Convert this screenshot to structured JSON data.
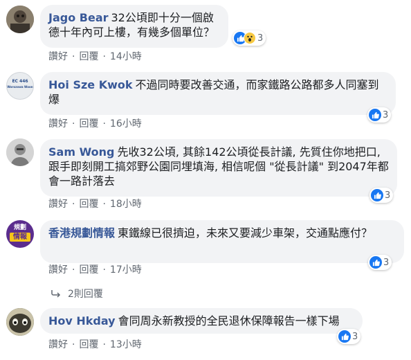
{
  "colors": {
    "name": "#385898",
    "bubble": "#f2f3f5",
    "like": "#1877f2",
    "meta": "#606770"
  },
  "actions": {
    "like": "讚好",
    "reply": "回覆",
    "sep": "·"
  },
  "comments": [
    {
      "name": "Jago Bear",
      "text": "32公頃即十分一個啟德十年內可上樓，有幾多個單位？",
      "time": "14小時",
      "reactions": "3",
      "icons": [
        "like-icon",
        "wow-icon"
      ]
    },
    {
      "name": "Hoi Sze Kwok",
      "text": "不過同時要改善交通，而家鐵路公路都多人同塞到爆",
      "time": "16小時",
      "reactions": "3",
      "avatar_text": [
        "EC 446",
        "Worozowa Woon"
      ],
      "icons": [
        "like-icon"
      ]
    },
    {
      "name": "Sam Wong",
      "text": "先收32公頃, 其餘142公頃從長計議, 先質住你地把口, 跟手即刻開工搞郊野公園同埋填海, 相信呢個 \"從長計議\" 到2047年都會一路計落去",
      "time": "18小時",
      "reactions": "3",
      "icons": [
        "like-icon"
      ]
    },
    {
      "name": "香港規劃情報",
      "text": "東鐵線已很擠迫，未來又要減少車架，交通點應付？",
      "time": "17小時",
      "reactions": "3",
      "avatar_text": [
        "規",
        "劃",
        "情報"
      ],
      "icons": [
        "like-icon"
      ]
    },
    {
      "name": "Hov Hkday",
      "text": "會同周永新教授的全民退休保障報告一樣下場",
      "time": "13小時",
      "reactions": "3",
      "icons": [
        "like-icon"
      ]
    }
  ],
  "replies_link": "2則回覆"
}
